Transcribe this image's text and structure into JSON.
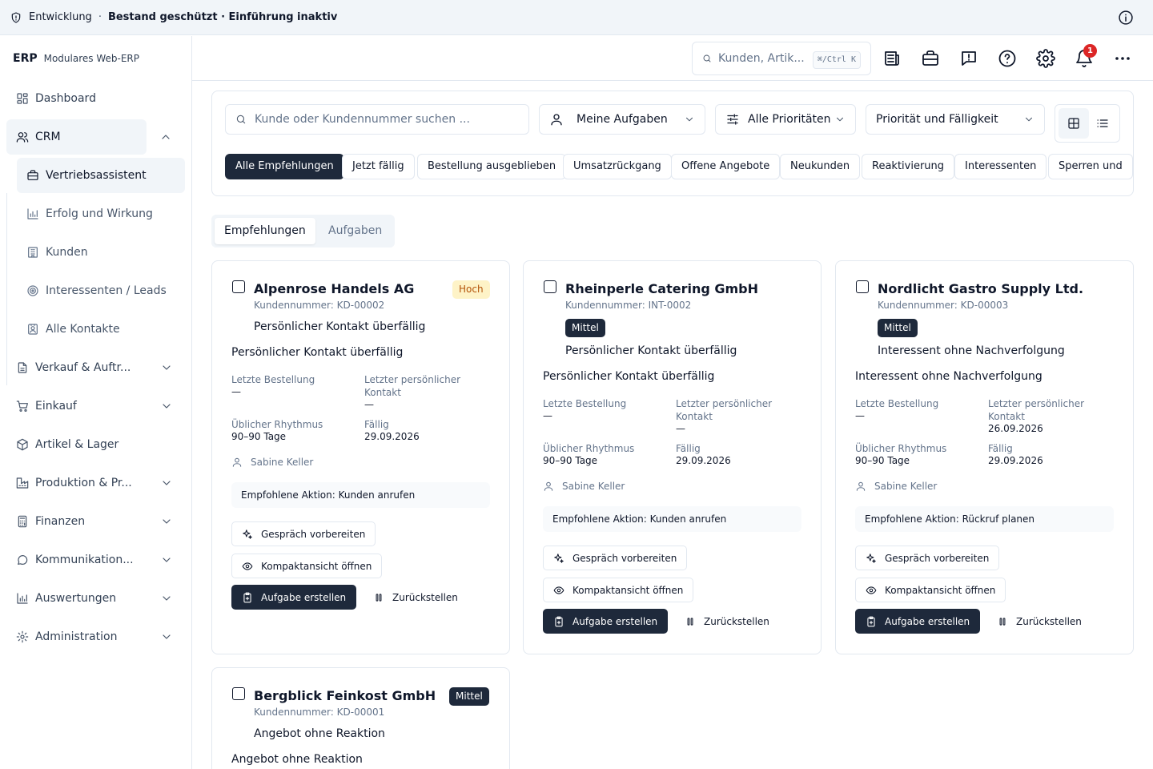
{
  "banner": {
    "environment": "Entwicklung",
    "separator": "·",
    "status": "Bestand geschützt · Einführung inaktiv"
  },
  "brand": {
    "name": "ERP",
    "subtitle": "Modulares Web-ERP"
  },
  "sidebar": {
    "items": [
      {
        "label": "Dashboard",
        "icon": "dashboard-icon"
      },
      {
        "label": "CRM",
        "icon": "users-icon",
        "expanded": true
      },
      {
        "label": "Verkauf & Auftr...",
        "icon": "document-icon"
      },
      {
        "label": "Einkauf",
        "icon": "cart-icon"
      },
      {
        "label": "Artikel & Lager",
        "icon": "package-icon"
      },
      {
        "label": "Produktion & Pr...",
        "icon": "factory-icon"
      },
      {
        "label": "Finanzen",
        "icon": "calculator-icon"
      },
      {
        "label": "Kommunikation...",
        "icon": "chat-icon"
      },
      {
        "label": "Auswertungen",
        "icon": "bar-chart-icon"
      },
      {
        "label": "Administration",
        "icon": "gear-icon"
      }
    ],
    "crm_sub": [
      {
        "label": "Vertriebsassistent",
        "icon": "briefcase-icon",
        "active": true
      },
      {
        "label": "Erfolg und Wirkung",
        "icon": "bar-chart-icon"
      },
      {
        "label": "Kunden",
        "icon": "building-icon"
      },
      {
        "label": "Interessenten / Leads",
        "icon": "target-icon"
      },
      {
        "label": "Alle Kontakte",
        "icon": "contact-icon"
      }
    ]
  },
  "header": {
    "search_placeholder": "Kunden, Artik...",
    "shortcut": "⌘/Ctrl K",
    "notification_count": "1"
  },
  "filters": {
    "search_placeholder": "Kunde oder Kundennummer suchen ...",
    "assignee": "Meine Aufgaben",
    "priority": "Alle Prioritäten",
    "sort": "Priorität und Fälligkeit",
    "chips": [
      "Alle Empfehlungen",
      "Jetzt fällig",
      "Bestellung ausgeblieben",
      "Umsatzrückgang",
      "Offene Angebote",
      "Neukunden",
      "Reaktivierung",
      "Interessenten",
      "Sperren und"
    ]
  },
  "tabs": [
    "Empfehlungen",
    "Aufgaben"
  ],
  "labels": {
    "last_order": "Letzte Bestellung",
    "last_contact": "Letzter persönlicher Kontakt",
    "rhythm": "Üblicher Rhythmus",
    "due": "Fällig",
    "prepare": "Gespräch vorbereiten",
    "compact": "Kompaktansicht öffnen",
    "create_task": "Aufgabe erstellen",
    "postpone": "Zurückstellen"
  },
  "cards": [
    {
      "name": "Alpenrose Handels AG",
      "number": "Kundennummer: KD-00002",
      "priority": "Hoch",
      "reason_short": "Persönlicher Kontakt überfällig",
      "reason": "Persönlicher Kontakt überfällig",
      "last_order": "—",
      "last_contact": "—",
      "rhythm": "90–90 Tage",
      "due": "29.09.2026",
      "owner": "Sabine Keller",
      "action": "Empfohlene Aktion: Kunden anrufen"
    },
    {
      "name": "Rheinperle Catering GmbH",
      "number": "Kundennummer: INT-0002",
      "priority": "Mittel",
      "reason_short": "Persönlicher Kontakt überfällig",
      "reason": "Persönlicher Kontakt überfällig",
      "last_order": "—",
      "last_contact": "—",
      "rhythm": "90–90 Tage",
      "due": "29.09.2026",
      "owner": "Sabine Keller",
      "action": "Empfohlene Aktion: Kunden anrufen"
    },
    {
      "name": "Nordlicht Gastro Supply Ltd.",
      "number": "Kundennummer: KD-00003",
      "priority": "Mittel",
      "reason_short": "Interessent ohne Nachverfolgung",
      "reason": "Interessent ohne Nachverfolgung",
      "last_order": "—",
      "last_contact": "26.09.2026",
      "rhythm": "90–90 Tage",
      "due": "29.09.2026",
      "owner": "Sabine Keller",
      "action": "Empfohlene Aktion: Rückruf planen"
    },
    {
      "name": "Bergblick Feinkost GmbH",
      "number": "Kundennummer: KD-00001",
      "priority": "Mittel",
      "reason_short": "Angebot ohne Reaktion",
      "reason": "Angebot ohne Reaktion"
    }
  ]
}
